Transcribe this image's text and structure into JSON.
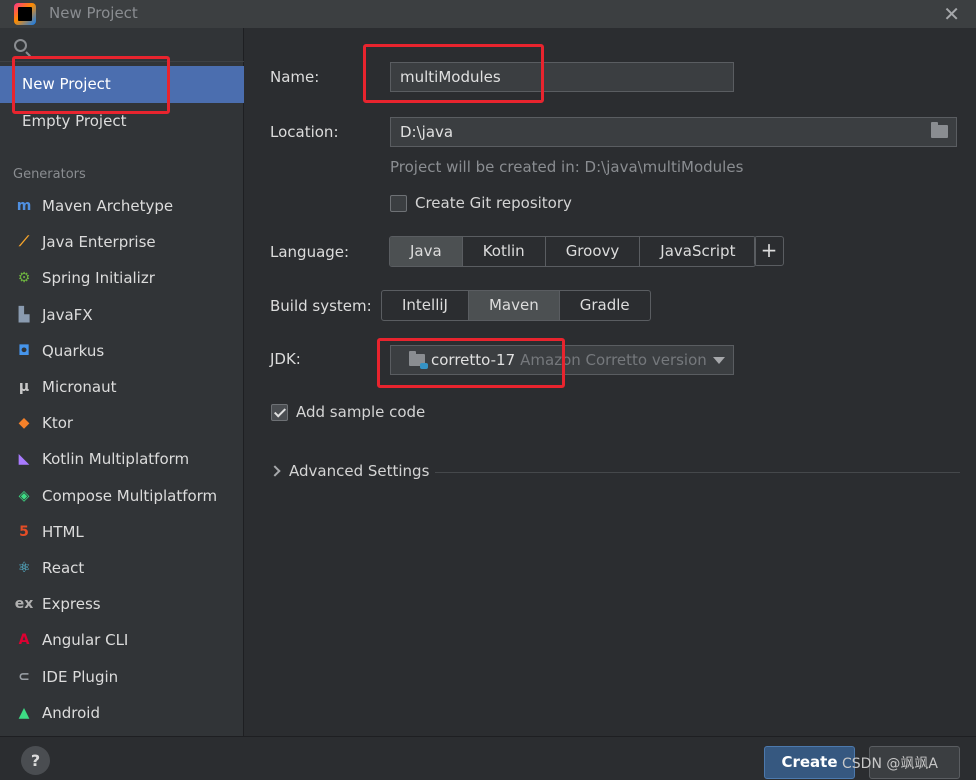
{
  "window": {
    "title": "New Project",
    "close_glyph": "✕"
  },
  "sidebar": {
    "items": [
      {
        "label": "New Project",
        "selected": true
      },
      {
        "label": "Empty Project",
        "selected": false
      }
    ],
    "generators_label": "Generators",
    "generators": [
      {
        "label": "Maven Archetype",
        "icon": "maven-icon",
        "color": "#4f8fe0",
        "glyph": "m"
      },
      {
        "label": "Java Enterprise",
        "icon": "java-enterprise-icon",
        "color": "#f7a52b",
        "glyph": "⟋"
      },
      {
        "label": "Spring Initializr",
        "icon": "spring-icon",
        "color": "#6db33f",
        "glyph": "⚙"
      },
      {
        "label": "JavaFX",
        "icon": "javafx-icon",
        "color": "#8a9bb0",
        "glyph": "▙"
      },
      {
        "label": "Quarkus",
        "icon": "quarkus-icon",
        "color": "#4695eb",
        "glyph": "◘"
      },
      {
        "label": "Micronaut",
        "icon": "micronaut-icon",
        "color": "#c8c8c8",
        "glyph": "μ"
      },
      {
        "label": "Ktor",
        "icon": "ktor-icon",
        "color": "#f5812a",
        "glyph": "◆"
      },
      {
        "label": "Kotlin Multiplatform",
        "icon": "kotlin-icon",
        "color": "#a97bff",
        "glyph": "◣"
      },
      {
        "label": "Compose Multiplatform",
        "icon": "compose-icon",
        "color": "#3ddc84",
        "glyph": "◈"
      },
      {
        "label": "HTML",
        "icon": "html-icon",
        "color": "#e44d26",
        "glyph": "5"
      },
      {
        "label": "React",
        "icon": "react-icon",
        "color": "#61dafb",
        "glyph": "⚛"
      },
      {
        "label": "Express",
        "icon": "express-icon",
        "color": "#b0b0b0",
        "glyph": "ex"
      },
      {
        "label": "Angular CLI",
        "icon": "angular-icon",
        "color": "#dd0031",
        "glyph": "A"
      },
      {
        "label": "IDE Plugin",
        "icon": "ide-plugin-icon",
        "color": "#9aa0a6",
        "glyph": "⊂"
      },
      {
        "label": "Android",
        "icon": "android-icon",
        "color": "#3ddc84",
        "glyph": "▲"
      }
    ]
  },
  "form": {
    "name_label": "Name:",
    "name_value": "multiModules",
    "location_label": "Location:",
    "location_value": "D:\\java",
    "location_hint": "Project will be created in: D:\\java\\multiModules",
    "git_label": "Create Git repository",
    "git_checked": false,
    "language_label": "Language:",
    "languages": [
      "Java",
      "Kotlin",
      "Groovy",
      "JavaScript"
    ],
    "language_selected": "Java",
    "add_language_glyph": "+",
    "build_label": "Build system:",
    "build_systems": [
      "IntelliJ",
      "Maven",
      "Gradle"
    ],
    "build_selected": "Maven",
    "jdk_label": "JDK:",
    "jdk_value": "corretto-17",
    "jdk_description": "Amazon Corretto version",
    "sample_label": "Add sample code",
    "sample_checked": true,
    "advanced_label": "Advanced Settings"
  },
  "footer": {
    "help_glyph": "?",
    "create_label": "Create",
    "watermark": "CSDN @飒飒A"
  },
  "colors": {
    "accent": "#4b6eaf",
    "annotation": "#e8242e"
  }
}
